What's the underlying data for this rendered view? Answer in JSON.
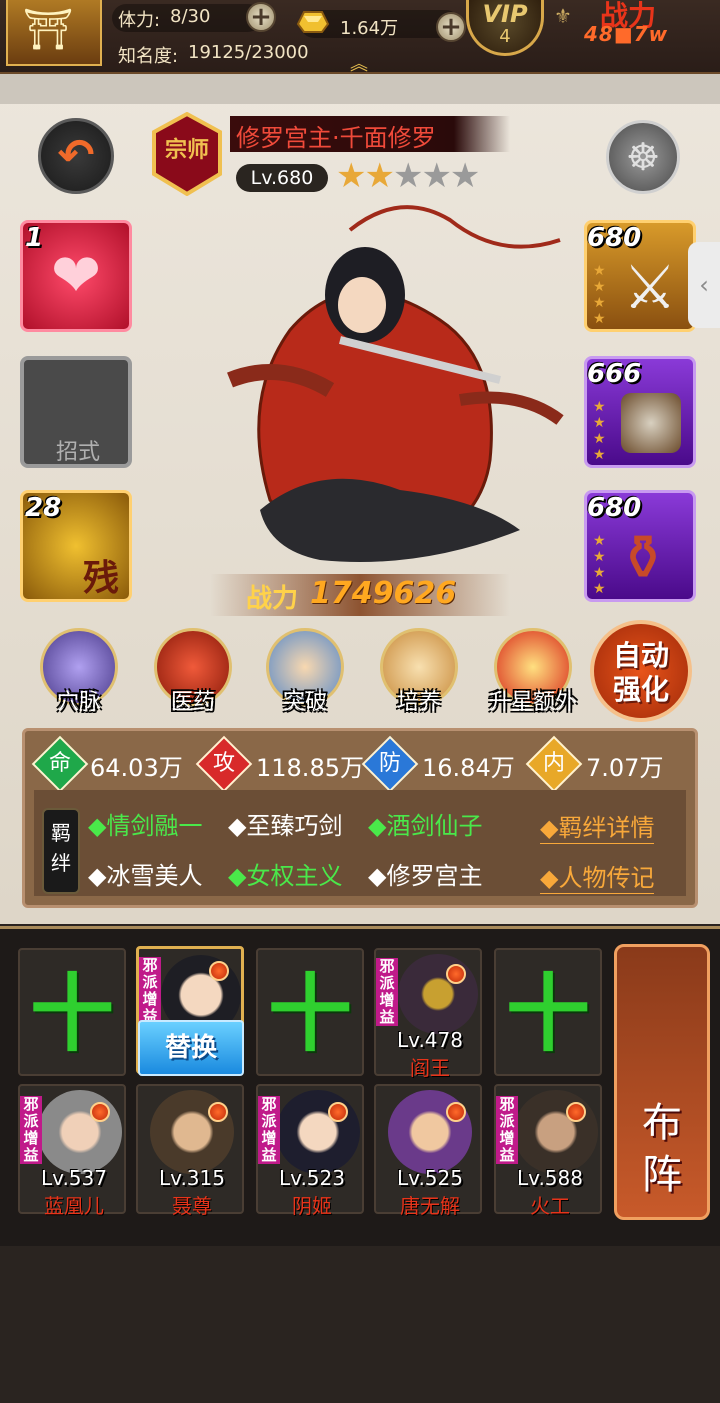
{
  "top": {
    "stamina_label": "体力:",
    "stamina_value": "8/30",
    "fame_label": "知名度:",
    "fame_value": "19125/23000",
    "gold_value": "1.64万",
    "vip_label": "VIP",
    "vip_level": "4",
    "power_label": "战力",
    "power_value": "48■7w"
  },
  "hero": {
    "badge_text": "宗师",
    "name": "修罗宫主·千面修罗",
    "level": "Lv.680",
    "stars_on": 2,
    "stars_total": 5,
    "stars_on_text": "★★",
    "stars_off_text": "★★★",
    "power_label": "战力",
    "power_value": "1749626"
  },
  "left_slots": {
    "skill1_num": "1",
    "move_label": "招式",
    "skill3_num": "28",
    "skill3_char": "残"
  },
  "right_slots": {
    "weapon_level": "680",
    "armor_level": "666",
    "accessory_level": "680"
  },
  "functions": [
    {
      "label": "穴脉"
    },
    {
      "label": "医药"
    },
    {
      "label": "突破"
    },
    {
      "label": "培养"
    },
    {
      "label": "升星额外"
    }
  ],
  "auto_strengthen": {
    "line1": "自动",
    "line2": "强化"
  },
  "attributes": [
    {
      "glyph": "命",
      "value": "64.03万",
      "color": "#1fa84a"
    },
    {
      "glyph": "攻",
      "value": "118.85万",
      "color": "#d82a2a"
    },
    {
      "glyph": "防",
      "value": "16.84万",
      "color": "#2a78d8"
    },
    {
      "glyph": "内",
      "value": "7.07万",
      "color": "#e8a828"
    }
  ],
  "bonds": {
    "tag": "羁绊",
    "row1": [
      {
        "text": "◆情剑融一",
        "color": "green"
      },
      {
        "text": "◆至臻巧剑",
        "color": "white"
      },
      {
        "text": "◆酒剑仙子",
        "color": "green"
      }
    ],
    "row2": [
      {
        "text": "◆冰雪美人",
        "color": "white"
      },
      {
        "text": "◆女权主义",
        "color": "green"
      },
      {
        "text": "◆修罗宫主",
        "color": "white"
      }
    ],
    "details_link": "◆羁绊详情",
    "biography_link": "◆人物传记"
  },
  "team": {
    "replace_label": "替换",
    "sect_tag": "邪派增益",
    "top_row": [
      {
        "type": "empty"
      },
      {
        "type": "hero",
        "level": "",
        "name": ""
      },
      {
        "type": "empty"
      },
      {
        "type": "hero",
        "level": "Lv.478",
        "name": "阎王"
      },
      {
        "type": "empty"
      }
    ],
    "bottom_row": [
      {
        "level": "Lv.537",
        "name": "蓝凰儿"
      },
      {
        "level": "Lv.315",
        "name": "聂尊"
      },
      {
        "level": "Lv.523",
        "name": "阴姬"
      },
      {
        "level": "Lv.525",
        "name": "唐无解"
      },
      {
        "level": "Lv.588",
        "name": "火工"
      }
    ],
    "formation_line1": "布",
    "formation_line2": "阵"
  }
}
